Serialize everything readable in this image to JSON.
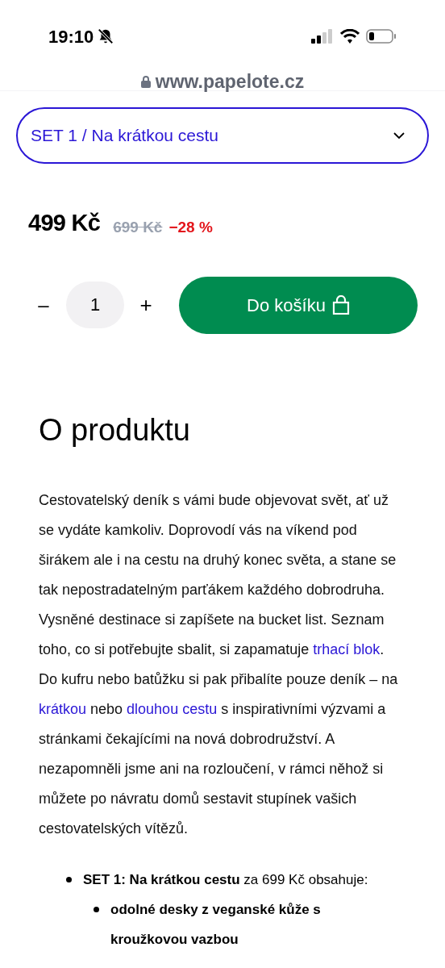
{
  "status_bar": {
    "time": "19:10",
    "silent": true
  },
  "address_bar": {
    "url": "www.papelote.cz"
  },
  "variant_select": {
    "value": "SET 1 / Na krátkou cestu"
  },
  "price": {
    "current": "499 Kč",
    "original": "699 Kč",
    "discount": "−28 %"
  },
  "quantity": {
    "minus": "–",
    "value": "1",
    "plus": "+"
  },
  "add_to_cart": {
    "label": "Do košíku"
  },
  "section": {
    "heading": "O produktu",
    "paragraph": [
      {
        "text": "Cestovatelský deník s vámi bude objevovat svět, ať už se vydáte kamkoliv. Doprovodí vás na víkend pod širákem ale i na cestu na druhý konec světa, a stane se tak nepostradatelným parťákem každého dobrodruha. Vysněné destinace si zapíšete na bucket list. Seznam toho, co si potřebujte sbalit, si zapamatuje ",
        "link": false
      },
      {
        "text": "trhací blok",
        "link": true
      },
      {
        "text": ". Do kufru nebo batůžku si pak přibalíte pouze deník – na ",
        "link": false
      },
      {
        "text": "krátkou",
        "link": true
      },
      {
        "text": " nebo ",
        "link": false
      },
      {
        "text": "dlouhou cestu",
        "link": true
      },
      {
        "text": " s inspirativními výzvami a stránkami čekajícími na nová dobrodružství. A nezapomněli jsme ani na rozloučení, v rámci něhož si můžete po návratu domů sestavit stupínek vašich cestovatelských vítězů.",
        "link": false
      }
    ],
    "list": [
      {
        "text": "**SET 1: Na krátkou cestu** za 699 Kč obsahuje:",
        "children": [
          {
            "text": "odolné desky z veganské kůže s kroužkovou vazbou"
          }
        ]
      }
    ]
  }
}
